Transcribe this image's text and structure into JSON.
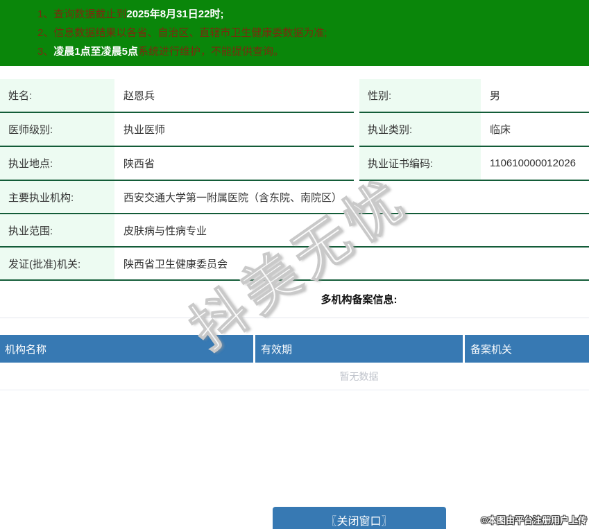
{
  "colors": {
    "banner_green": "#0a860a",
    "banner_text_dark": "#7a2b0e",
    "banner_text_highlight": "#ffffff",
    "table_border_green": "#135c38",
    "label_cell_mint": "#edfbf2",
    "table_header_blue": "#3779b3",
    "close_button_blue": "#3779b3",
    "empty_text_gray": "#bfc3cb"
  },
  "banner": {
    "lines": [
      {
        "num": "1、",
        "pre": "查询数据截止到",
        "highlight": "2025年8月31日22时;",
        "post": ""
      },
      {
        "num": "2、",
        "pre": "信息数据结果以各省、自治区、直辖市卫生健康委数据为准;",
        "highlight": "",
        "post": ""
      },
      {
        "num": "3、",
        "pre": "",
        "highlight": "凌晨1点至凌晨5点",
        "post": "系统进行维护，不能提供查询。"
      }
    ]
  },
  "profile": {
    "pair_rows": [
      {
        "label_left": "姓名:",
        "value_left": "赵恩兵",
        "label_right": "性别:",
        "value_right": "男"
      },
      {
        "label_left": "医师级别:",
        "value_left": "执业医师",
        "label_right": "执业类别:",
        "value_right": "临床"
      },
      {
        "label_left": "执业地点:",
        "value_left": "陕西省",
        "label_right": "执业证书编码:",
        "value_right": "110610000012026"
      }
    ],
    "full_rows": [
      {
        "label": "主要执业机构:",
        "value": "西安交通大学第一附属医院（含东院、南院区）"
      },
      {
        "label": "执业范围:",
        "value": "皮肤病与性病专业"
      },
      {
        "label": "发证(批准)机关:",
        "value": "陕西省卫生健康委员会"
      }
    ]
  },
  "filing": {
    "heading": "多机构备案信息:",
    "columns": [
      "机构名称",
      "有效期",
      "备案机关"
    ],
    "empty_text": "暂无数据"
  },
  "footer": {
    "close_button": "〖关闭窗口〗",
    "copyright": "©本图由平台注册用户上传"
  },
  "watermark": {
    "text": "抖美无忧"
  }
}
